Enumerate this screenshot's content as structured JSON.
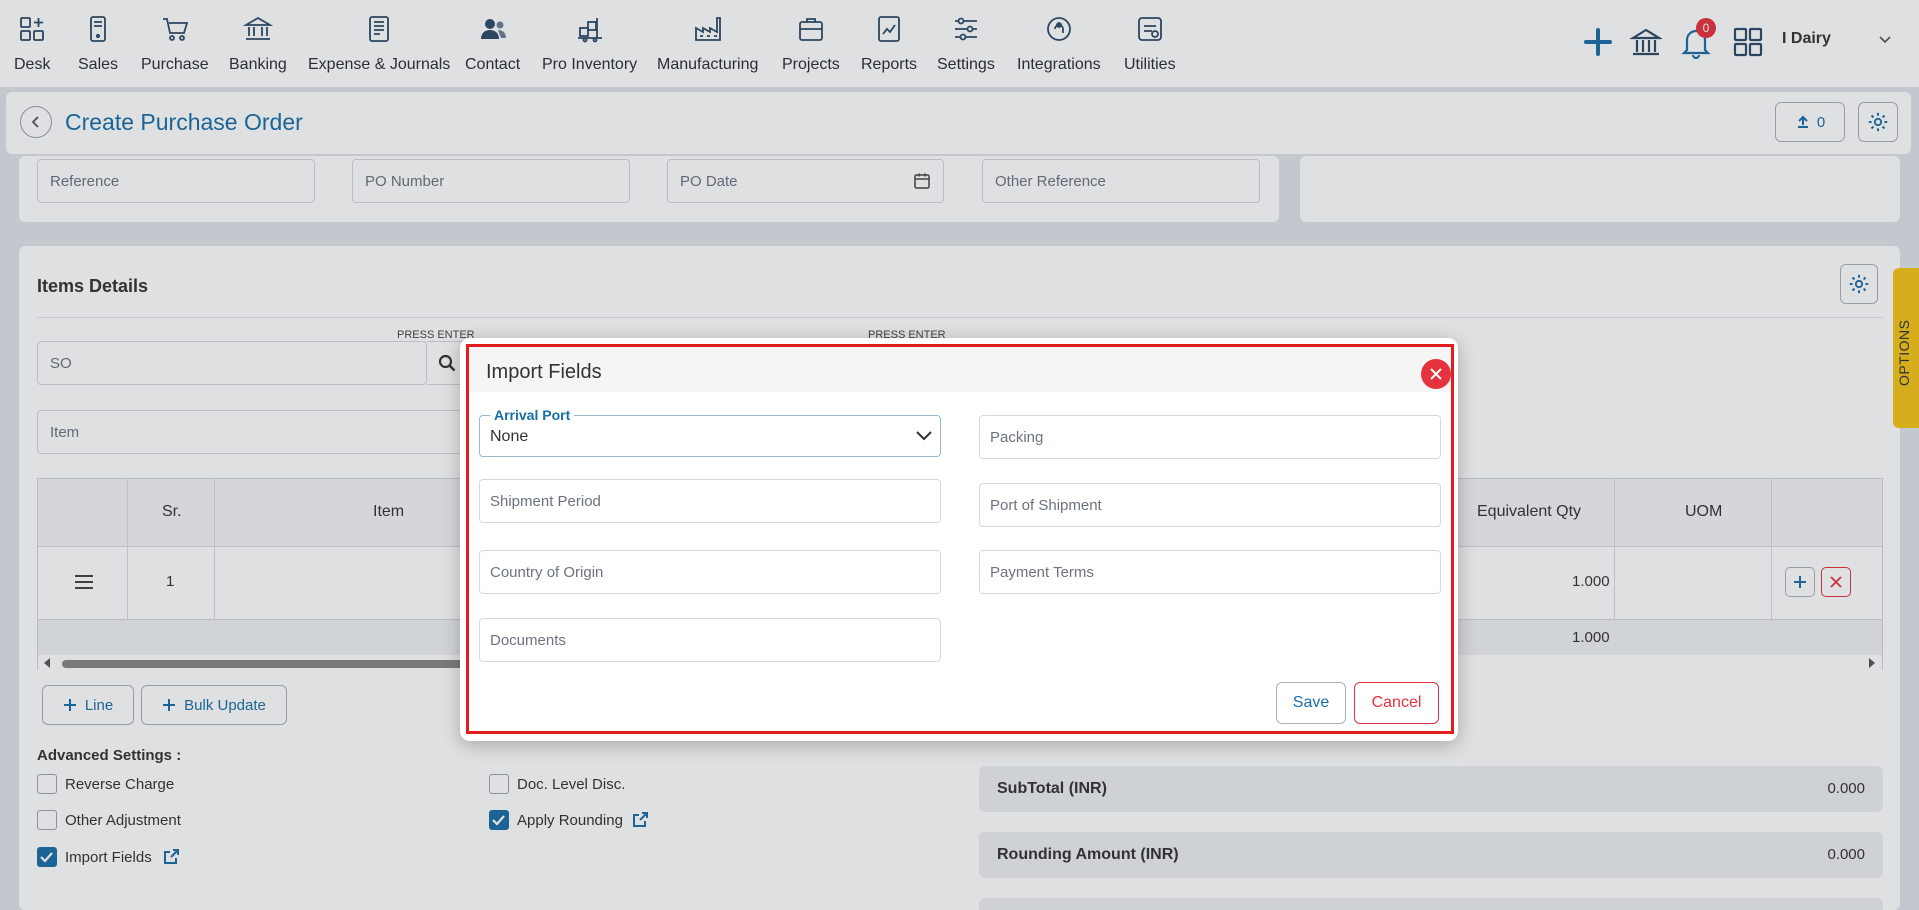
{
  "nav": {
    "items": [
      {
        "label": "Desk",
        "icon": "desk-icon"
      },
      {
        "label": "Sales",
        "icon": "sales-icon"
      },
      {
        "label": "Purchase",
        "icon": "cart-icon"
      },
      {
        "label": "Banking",
        "icon": "bank-icon"
      },
      {
        "label": "Expense & Journals",
        "icon": "journal-icon"
      },
      {
        "label": "Contact",
        "icon": "contacts-icon"
      },
      {
        "label": "Pro Inventory",
        "icon": "inventory-icon"
      },
      {
        "label": "Manufacturing",
        "icon": "factory-icon"
      },
      {
        "label": "Projects",
        "icon": "projects-icon"
      },
      {
        "label": "Reports",
        "icon": "reports-icon"
      },
      {
        "label": "Settings",
        "icon": "sliders-icon"
      },
      {
        "label": "Integrations",
        "icon": "integrations-icon"
      },
      {
        "label": "Utilities",
        "icon": "utilities-icon"
      }
    ],
    "notification_count": "0",
    "user_name": "I Dairy"
  },
  "header": {
    "title": "Create Purchase Order",
    "upload_count": "0"
  },
  "form": {
    "reference_placeholder": "Reference",
    "po_number_placeholder": "PO Number",
    "po_date_placeholder": "PO Date",
    "other_reference_placeholder": "Other Reference"
  },
  "items": {
    "title": "Items Details",
    "press_enter_1": "PRESS ENTER",
    "press_enter_2": "PRESS ENTER",
    "so_placeholder": "SO",
    "item_placeholder": "Item",
    "columns": [
      "Sr.",
      "Item",
      "Equivalent Qty",
      "UOM"
    ],
    "row": {
      "sr": "1",
      "equivalent_qty": "1.000"
    },
    "total_equivalent_qty": "1.000",
    "line_button": "Line",
    "bulk_update_button": "Bulk Update"
  },
  "advanced": {
    "title": "Advanced Settings :",
    "reverse_charge": "Reverse Charge",
    "other_adjustment": "Other Adjustment",
    "import_fields": "Import Fields",
    "doc_level_disc": "Doc. Level Disc.",
    "apply_rounding": "Apply Rounding"
  },
  "summary": {
    "subtotal_label": "SubTotal (INR)",
    "subtotal_value": "0.000",
    "rounding_label": "Rounding Amount (INR)",
    "rounding_value": "0.000"
  },
  "options_tab": "OPTIONS",
  "modal": {
    "title": "Import Fields",
    "arrival_port_label": "Arrival Port",
    "arrival_port_value": "None",
    "packing_placeholder": "Packing",
    "shipment_period_placeholder": "Shipment Period",
    "port_of_shipment_placeholder": "Port of Shipment",
    "country_of_origin_placeholder": "Country of Origin",
    "payment_terms_placeholder": "Payment Terms",
    "documents_placeholder": "Documents",
    "save_label": "Save",
    "cancel_label": "Cancel"
  },
  "colors": {
    "accent": "#1a6ea6",
    "danger": "#e5323e",
    "highlight": "#e01e1e",
    "options_tab": "#f5c518"
  }
}
